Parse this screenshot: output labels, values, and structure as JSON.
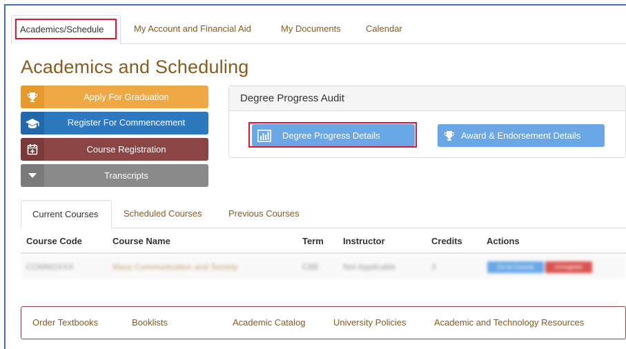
{
  "top_tabs": [
    {
      "label": "Academics/Schedule",
      "active": true
    },
    {
      "label": "My Account and Financial Aid",
      "active": false
    },
    {
      "label": "My Documents",
      "active": false
    },
    {
      "label": "Calendar",
      "active": false
    }
  ],
  "page_title": "Academics and Scheduling",
  "side_buttons": {
    "graduation": {
      "label": "Apply For Graduation",
      "icon": "trophy-icon"
    },
    "commencement": {
      "label": "Register For Commencement",
      "icon": "graduation-cap-icon"
    },
    "registration": {
      "label": "Course Registration",
      "icon": "calendar-plus-icon"
    },
    "transcripts": {
      "label": "Transcripts",
      "icon": "caret-down-icon"
    }
  },
  "degree_progress": {
    "title": "Degree Progress Audit",
    "details_label": "Degree Progress Details",
    "award_label": "Award & Endorsement Details"
  },
  "course_tabs": [
    {
      "label": "Current Courses",
      "active": true
    },
    {
      "label": "Scheduled Courses",
      "active": false
    },
    {
      "label": "Previous Courses",
      "active": false
    }
  ],
  "table": {
    "headers": [
      "Course Code",
      "Course Name",
      "Term",
      "Instructor",
      "Credits",
      "Actions"
    ],
    "rows": [
      {
        "code": "COMM2XXX",
        "name": "Mass Communication and Society",
        "term": "CBE",
        "instructor": "Not Applicable",
        "credits": "3",
        "action1": "Go to Course",
        "action2": "Unregister"
      }
    ]
  },
  "footer_links": [
    "Order Textbooks",
    "Booklists",
    "Academic Catalog",
    "University Policies",
    "Academic and Technology Resources"
  ],
  "colors": {
    "accent_brown": "#8a5a1e",
    "orange": "#eea945",
    "blue": "#2e78c0",
    "maroon": "#8b4545",
    "gray": "#8a8a8a",
    "light_blue": "#6aa7e6",
    "highlight_red": "#d9182d"
  }
}
